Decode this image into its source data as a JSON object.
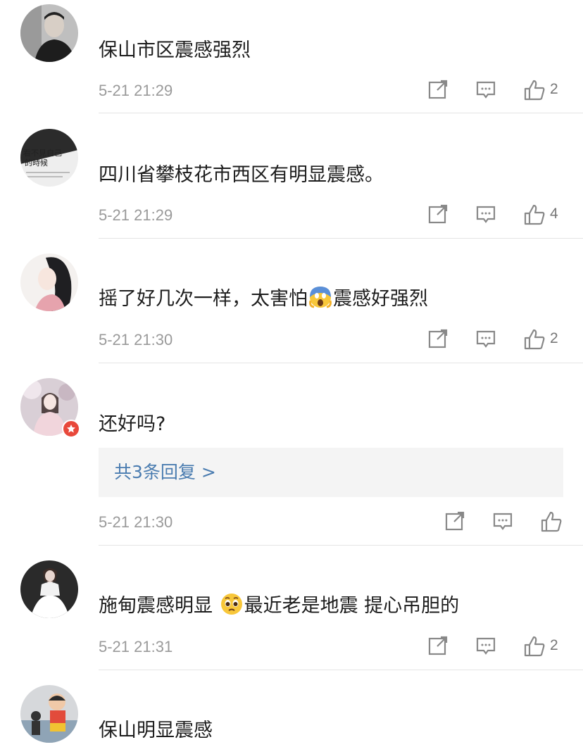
{
  "comments": [
    {
      "text": "保山市区震感强烈",
      "time": "5-21 21:29",
      "likes": "2"
    },
    {
      "text": "四川省攀枝花市西区有明显震感。",
      "time": "5-21 21:29",
      "likes": "4"
    },
    {
      "text_before": "摇了好几次一样，太害怕",
      "emoji": "scream-emoji",
      "text_after": "震感好强烈",
      "time": "5-21 21:30",
      "likes": "2"
    },
    {
      "text": "还好吗?",
      "replies": "共3条回复 >",
      "time": "5-21 21:30",
      "likes": ""
    },
    {
      "text_before": "施甸震感明显 ",
      "emoji": "pleading-emoji",
      "text_after": "最近老是地震 提心吊胆的",
      "time": "5-21 21:31",
      "likes": "2"
    },
    {
      "text": "保山明显震感"
    }
  ],
  "icons": {
    "share": "share-icon",
    "reply": "reply-icon",
    "like": "thumbs-up-icon",
    "badge": "verified-badge-icon"
  },
  "avatar_book_text": "看不見自己的時候",
  "colors": {
    "link": "#4a7cb0",
    "time": "#9a9a9a",
    "badge": "#e8483b"
  }
}
